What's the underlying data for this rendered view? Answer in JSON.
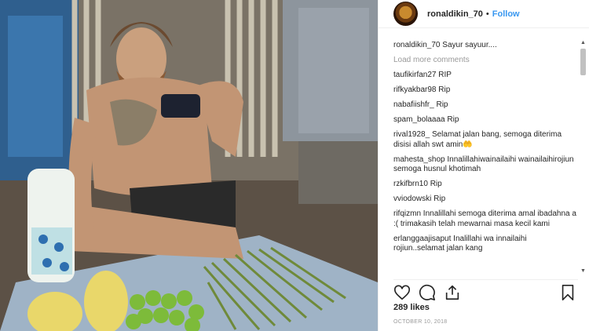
{
  "post": {
    "username": "ronaldikin_70",
    "separator": "•",
    "follow_label": "Follow",
    "caption_user": "ronaldikin_70",
    "caption_text": "Sayur sayuur....",
    "load_more": "Load more comments",
    "likes": "289 likes",
    "date": "OCTOBER 10, 2018"
  },
  "comments": [
    {
      "user": "taufikirfan27",
      "text": "RIP"
    },
    {
      "user": "rifkyakbar98",
      "text": "Rip"
    },
    {
      "user": "nabafiishfr_",
      "text": "Rip"
    },
    {
      "user": "spam_bolaaaa",
      "text": "Rip"
    },
    {
      "user": "rival1928_",
      "text": "Selamat jalan bang, semoga diterima disisi allah swt amin🤲"
    },
    {
      "user": "mahesta_shop",
      "text": "Innalillahiwainailaihi wainailaihirojiun semoga husnul khotimah"
    },
    {
      "user": "rzkifbrn10",
      "text": "Rip"
    },
    {
      "user": "vviodowski",
      "text": "Rip"
    },
    {
      "user": "rifqizmn",
      "text": "Innalillahi semoga diterima amal ibadahna a :( trimakasih telah mewarnai masa kecil kami"
    },
    {
      "user": "erlanggaajisaput",
      "text": "Inalillahi wa innailaihi rojiun..selamat jalan kang"
    }
  ],
  "icons": {
    "like": "heart-icon",
    "comment": "comment-icon",
    "share": "share-icon",
    "save": "bookmark-icon"
  },
  "colors": {
    "follow": "#3897f0",
    "muted": "#999999",
    "text": "#262626"
  }
}
